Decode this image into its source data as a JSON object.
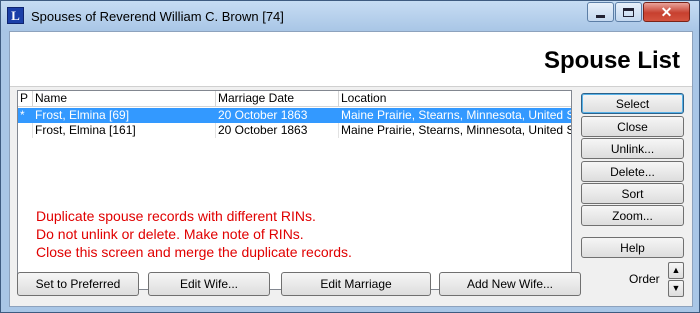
{
  "window": {
    "app_icon_letter": "L",
    "title": "Spouses of Reverend William C. Brown [74]",
    "min_icon": "minimize-icon",
    "max_icon": "maximize-icon",
    "close_icon": "close-icon",
    "close_glyph": "✕"
  },
  "page_title": "Spouse List",
  "list": {
    "columns": [
      "P",
      "Name",
      "Marriage Date",
      "Location"
    ],
    "rows": [
      {
        "p": "*",
        "name": "Frost, Elmina [69]",
        "date": "20 October 1863",
        "location": "Maine Prairie, Stearns, Minnesota, United Sta",
        "selected": true
      },
      {
        "p": "",
        "name": "Frost, Elmina [161]",
        "date": "20 October 1863",
        "location": "Maine Prairie, Stearns, Minnesota, United Sta",
        "selected": false
      }
    ]
  },
  "warning": {
    "lines": [
      "Duplicate spouse records with different RINs.",
      "Do not unlink or delete. Make note of RINs.",
      "Close this screen and merge the duplicate records."
    ],
    "color": "#e00000"
  },
  "side_buttons": {
    "select": "Select",
    "close": "Close",
    "unlink": "Unlink...",
    "delete": "Delete...",
    "sort": "Sort",
    "zoom": "Zoom...",
    "help": "Help"
  },
  "bottom_buttons": {
    "set_preferred": "Set to Preferred",
    "edit_wife": "Edit Wife...",
    "edit_marriage": "Edit Marriage",
    "add_new_wife": "Add New Wife..."
  },
  "order": {
    "label": "Order",
    "up_glyph": "▲",
    "down_glyph": "▼"
  },
  "colors": {
    "selection": "#3399ff",
    "close_button": "#c7402f",
    "frame": "#a9c6e6"
  }
}
